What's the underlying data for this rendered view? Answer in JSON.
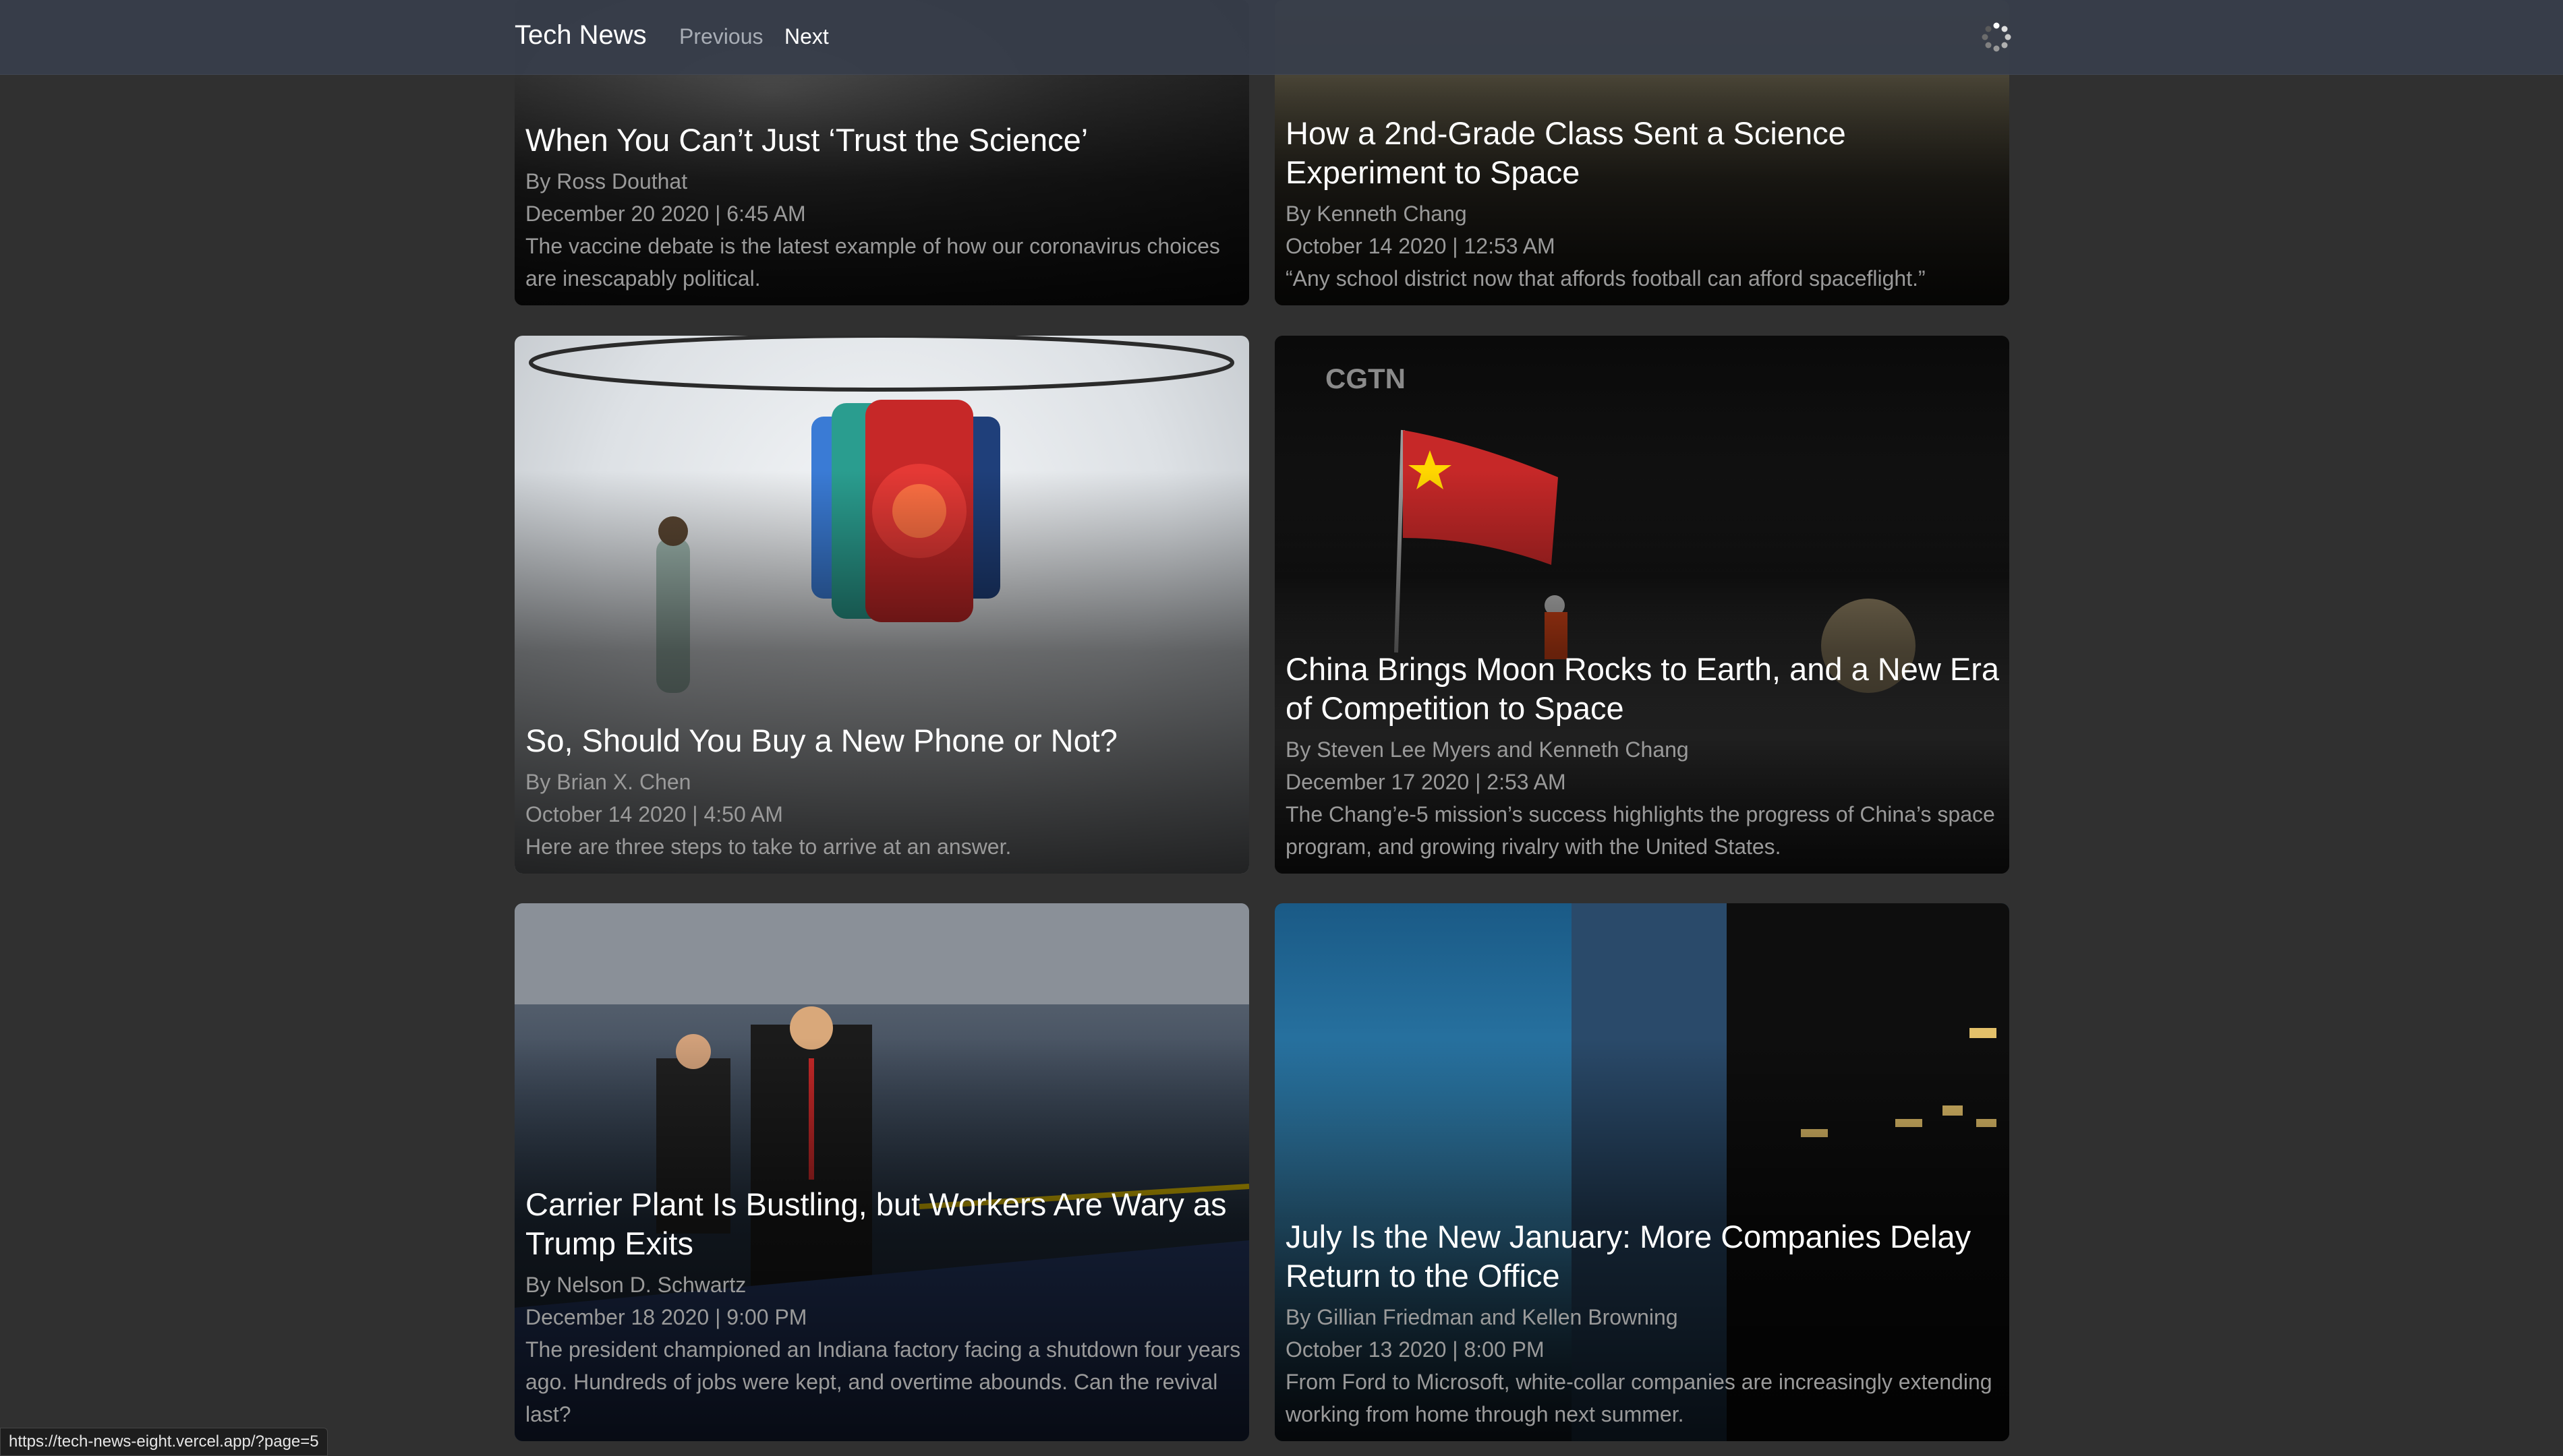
{
  "navbar": {
    "brand": "Tech News",
    "previous_label": "Previous",
    "next_label": "Next",
    "loading_icon": "spinner-icon"
  },
  "articles": [
    {
      "title": "When You Can’t Just ‘Trust the Science’",
      "byline": "By Ross Douthat",
      "date": "December 20 2020 | 6:45 AM",
      "description": "The vaccine debate is the latest example of how our coronavirus choices are inescapably political."
    },
    {
      "title": "How a 2nd-Grade Class Sent a Science Experiment to Space",
      "byline": "By Kenneth Chang",
      "date": "October 14 2020 | 12:53 AM",
      "description": "“Any school district now that affords football can afford spaceflight.”"
    },
    {
      "title": "So, Should You Buy a New Phone or Not?",
      "byline": "By Brian X. Chen",
      "date": "October 14 2020 | 4:50 AM",
      "description": "Here are three steps to take to arrive at an answer."
    },
    {
      "title": "China Brings Moon Rocks to Earth, and a New Era of Competition to Space",
      "byline": "By Steven Lee Myers and Kenneth Chang",
      "date": "December 17 2020 | 2:53 AM",
      "description": "The Chang’e-5 mission’s success highlights the progress of China’s space program, and growing rivalry with the United States.",
      "image_text": "CGTN"
    },
    {
      "title": "Carrier Plant Is Bustling, but Workers Are Wary as Trump Exits",
      "byline": "By Nelson D. Schwartz",
      "date": "December 18 2020 | 9:00 PM",
      "description": "The president championed an Indiana factory facing a shutdown four years ago. Hundreds of jobs were kept, and overtime abounds. Can the revival last?"
    },
    {
      "title": "July Is the New January: More Companies Delay Return to the Office",
      "byline": "By Gillian Friedman and Kellen Browning",
      "date": "October 13 2020 | 8:00 PM",
      "description": "From Ford to Microsoft, white-collar companies are increasingly extending working from home through next summer."
    }
  ],
  "status_bar": {
    "url": "https://tech-news-eight.vercel.app/?page=5"
  },
  "colors": {
    "page_background": "#303030",
    "navbar_background": "#373e4a",
    "meta_text": "#9a9a9a"
  }
}
